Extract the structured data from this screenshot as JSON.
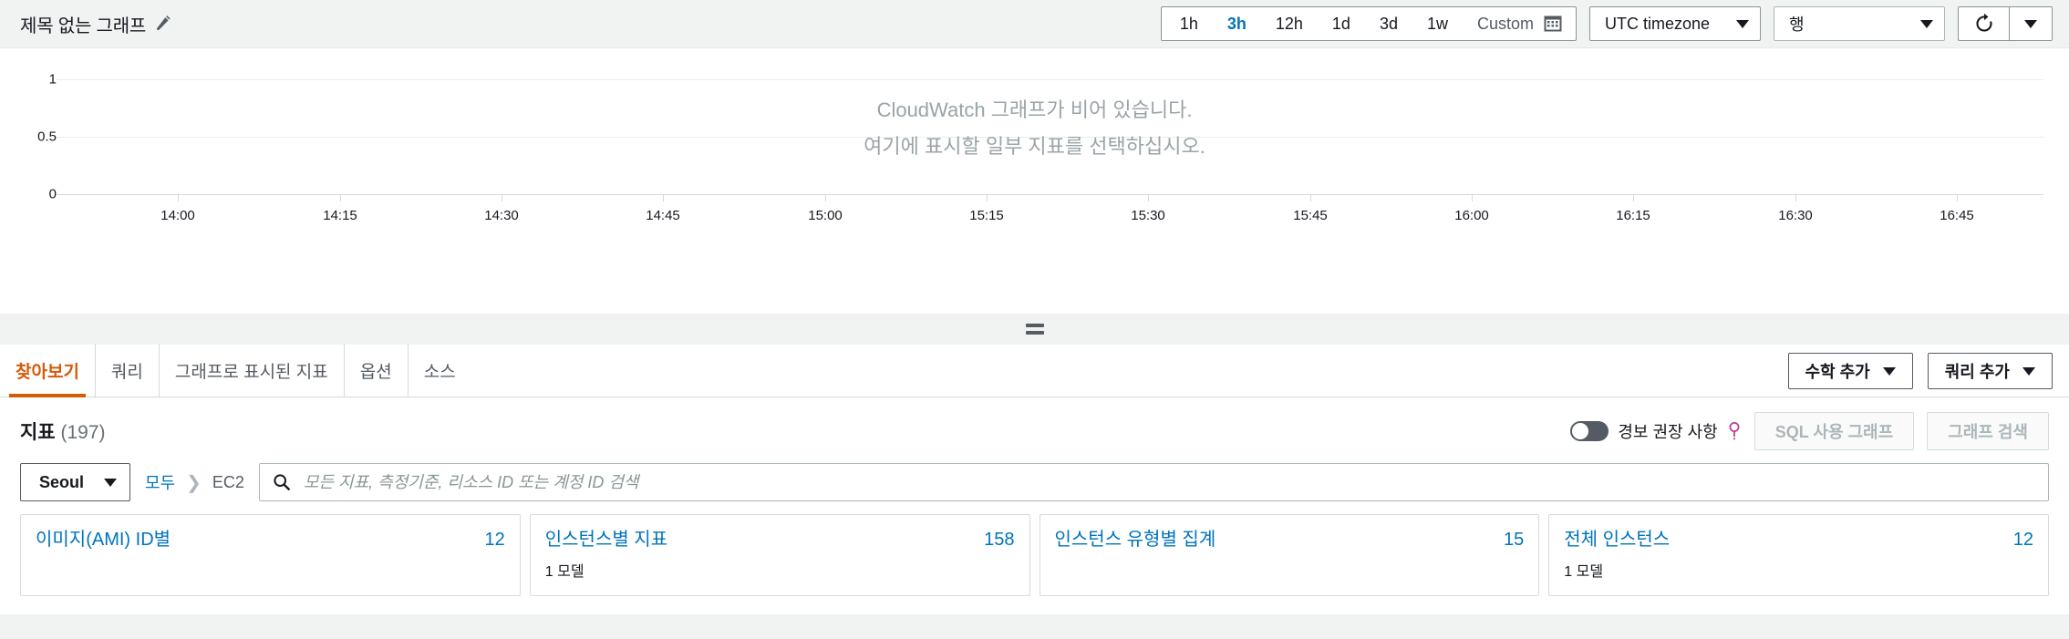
{
  "header": {
    "graph_title": "제목 없는 그래프",
    "edit_icon": "pencil-icon",
    "time_ranges": [
      {
        "label": "1h",
        "active": false
      },
      {
        "label": "3h",
        "active": true
      },
      {
        "label": "12h",
        "active": false
      },
      {
        "label": "1d",
        "active": false
      },
      {
        "label": "3d",
        "active": false
      },
      {
        "label": "1w",
        "active": false
      }
    ],
    "custom_label": "Custom",
    "calendar_icon": "calendar-icon",
    "timezone_value": "UTC timezone",
    "rows_value": "행",
    "refresh_icon": "refresh-icon"
  },
  "chart": {
    "empty_line1": "CloudWatch 그래프가 비어 있습니다.",
    "empty_line2": "여기에 표시할 일부 지표를 선택하십시오."
  },
  "chart_data": {
    "type": "line",
    "title": "제목 없는 그래프",
    "series": [],
    "x": [
      "14:00",
      "14:15",
      "14:30",
      "14:45",
      "15:00",
      "15:15",
      "15:30",
      "15:45",
      "16:00",
      "16:15",
      "16:30",
      "16:45"
    ],
    "xlabel": "",
    "ylabel": "",
    "yticks": [
      "1",
      "0.5",
      "0"
    ],
    "ylim": [
      0,
      1
    ],
    "grid": true,
    "legend": "none",
    "empty": true,
    "empty_message": "CloudWatch 그래프가 비어 있습니다. 여기에 표시할 일부 지표를 선택하십시오."
  },
  "tabs": [
    {
      "label": "찾아보기",
      "active": true
    },
    {
      "label": "쿼리",
      "active": false
    },
    {
      "label": "그래프로 표시된 지표",
      "active": false
    },
    {
      "label": "옵션",
      "active": false
    },
    {
      "label": "소스",
      "active": false
    }
  ],
  "tab_actions": {
    "add_math": "수학 추가",
    "add_query": "쿼리 추가"
  },
  "metrics": {
    "title": "지표",
    "count": "(197)",
    "alarm_toggle_label": "경보 권장 사항",
    "info_icon": "info-icon",
    "sql_graph_button": "SQL 사용 그래프",
    "search_graph_button": "그래프 검색",
    "region": "Seoul",
    "breadcrumb_root": "모두",
    "breadcrumb_sep": "❯",
    "breadcrumb_current": "EC2",
    "search_placeholder": "모든 지표, 측정기준, 리소스 ID 또는 계정 ID 검색",
    "search_value": "",
    "search_icon": "search-icon",
    "cards": [
      {
        "title": "이미지(AMI) ID별",
        "count": "12",
        "sub": ""
      },
      {
        "title": "인스턴스별 지표",
        "count": "158",
        "sub": "1 모델"
      },
      {
        "title": "인스턴스 유형별 집계",
        "count": "15",
        "sub": ""
      },
      {
        "title": "전체 인스턴스",
        "count": "12",
        "sub": "1 모델"
      }
    ]
  },
  "colors": {
    "accent_blue": "#0073bb",
    "accent_orange": "#d45b07",
    "page_bg": "#f1f3f3",
    "panel_bg": "#ffffff"
  }
}
